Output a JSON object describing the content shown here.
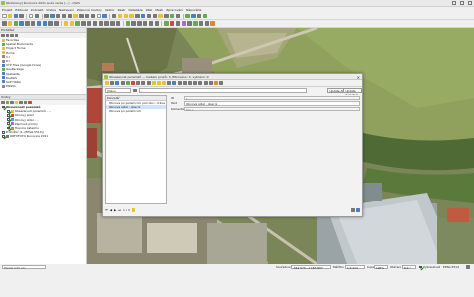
{
  "window": {
    "title": "[Rozsireny] Kunovice 2021 suda verze [...] - QGIS"
  },
  "menu": [
    "Projekt",
    "Editovat",
    "Zobrazit",
    "Vrstva",
    "Nastavení",
    "Zásuvné moduly",
    "Vektor",
    "Rastr",
    "Databáze",
    "Web",
    "Mesh",
    "Zpracování",
    "Nápověda"
  ],
  "browser_panel": {
    "title": "Prohlížeč",
    "items": [
      "Favorites",
      "Spatial Bookmarks",
      "Project Home",
      "Home",
      "C:\\",
      "D:\\",
      "XYZ Tiles (Google Drive)",
      "GeoPackage",
      "Spatialite",
      "PostGIS",
      "SAP HANA",
      "MSSQL"
    ]
  },
  "layers_panel": {
    "title": "Vrstvy",
    "layers": [
      {
        "label": "Obsazenost pozemků",
        "checked": true,
        "bold": true,
        "indent": 0,
        "color": ""
      },
      {
        "label": "Obsazenost pozemků - ...",
        "checked": true,
        "bold": false,
        "indent": 1,
        "color": "#e6c23a"
      },
      {
        "label": "Obnovy sídel",
        "checked": true,
        "bold": false,
        "indent": 1,
        "color": "#d64b3a"
      },
      {
        "label": "Obnovy sídel - ...",
        "checked": true,
        "bold": false,
        "indent": 1,
        "color": "#5a9fd4"
      },
      {
        "label": "Zájmové plochy",
        "checked": true,
        "bold": false,
        "indent": 1,
        "color": "#b067c9"
      },
      {
        "label": "Hranice katastru",
        "checked": true,
        "bold": false,
        "indent": 1,
        "color": "#e28a2b"
      },
      {
        "label": "Prohlížeč (1, (EPSG:5514))",
        "checked": false,
        "bold": false,
        "indent": 0,
        "color": ""
      },
      {
        "label": "ORTOFOTO Kunovice 2021",
        "checked": true,
        "bold": false,
        "indent": 0,
        "color": "#777777"
      }
    ]
  },
  "dialog": {
    "title": "Obsazenost pozemků — Celkem prvků: 3, filtrováno: 3, vybráno: 0",
    "expr_field": "Jméno",
    "expr_value": "... ",
    "update_all_label": "Update All",
    "update_selected_label": "Update Selected",
    "list_header": "Kancelář",
    "list_rows": [
      "Obnova po pozemcích pod obcí - tráva",
      "Obnova sídel - obecní",
      "Obnova po pozemcích"
    ],
    "fields": [
      {
        "label": "ID",
        "value": "1",
        "readonly": true
      },
      {
        "label": "Text",
        "value": "Obnova sídel - obecní",
        "readonly": false
      },
      {
        "label": "Komentář",
        "value": "NULL",
        "readonly": true
      }
    ],
    "pager": "1 / 3"
  },
  "statusbar": {
    "locator_placeholder": "Hledat (Ctrl+K)",
    "coord_label": "Souřadnice",
    "coord_value": "-561 573, -1 183 807",
    "scale_label": "Měřítko",
    "scale_value": "1:4 213",
    "magnifier_label": "Lupa",
    "magnifier_value": "100%",
    "rotation_label": "Otáčení",
    "rotation_value": "0,0 °",
    "render_label": "Vykreslovat",
    "crs": "EPSG:5514"
  }
}
